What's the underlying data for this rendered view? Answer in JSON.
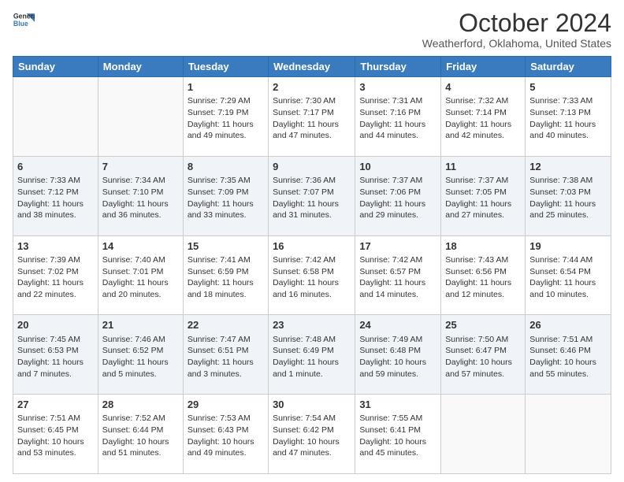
{
  "header": {
    "logo_line1": "General",
    "logo_line2": "Blue",
    "title": "October 2024",
    "subtitle": "Weatherford, Oklahoma, United States"
  },
  "days_of_week": [
    "Sunday",
    "Monday",
    "Tuesday",
    "Wednesday",
    "Thursday",
    "Friday",
    "Saturday"
  ],
  "weeks": [
    [
      {
        "day": "",
        "sunrise": "",
        "sunset": "",
        "daylight": ""
      },
      {
        "day": "",
        "sunrise": "",
        "sunset": "",
        "daylight": ""
      },
      {
        "day": "1",
        "sunrise": "Sunrise: 7:29 AM",
        "sunset": "Sunset: 7:19 PM",
        "daylight": "Daylight: 11 hours and 49 minutes."
      },
      {
        "day": "2",
        "sunrise": "Sunrise: 7:30 AM",
        "sunset": "Sunset: 7:17 PM",
        "daylight": "Daylight: 11 hours and 47 minutes."
      },
      {
        "day": "3",
        "sunrise": "Sunrise: 7:31 AM",
        "sunset": "Sunset: 7:16 PM",
        "daylight": "Daylight: 11 hours and 44 minutes."
      },
      {
        "day": "4",
        "sunrise": "Sunrise: 7:32 AM",
        "sunset": "Sunset: 7:14 PM",
        "daylight": "Daylight: 11 hours and 42 minutes."
      },
      {
        "day": "5",
        "sunrise": "Sunrise: 7:33 AM",
        "sunset": "Sunset: 7:13 PM",
        "daylight": "Daylight: 11 hours and 40 minutes."
      }
    ],
    [
      {
        "day": "6",
        "sunrise": "Sunrise: 7:33 AM",
        "sunset": "Sunset: 7:12 PM",
        "daylight": "Daylight: 11 hours and 38 minutes."
      },
      {
        "day": "7",
        "sunrise": "Sunrise: 7:34 AM",
        "sunset": "Sunset: 7:10 PM",
        "daylight": "Daylight: 11 hours and 36 minutes."
      },
      {
        "day": "8",
        "sunrise": "Sunrise: 7:35 AM",
        "sunset": "Sunset: 7:09 PM",
        "daylight": "Daylight: 11 hours and 33 minutes."
      },
      {
        "day": "9",
        "sunrise": "Sunrise: 7:36 AM",
        "sunset": "Sunset: 7:07 PM",
        "daylight": "Daylight: 11 hours and 31 minutes."
      },
      {
        "day": "10",
        "sunrise": "Sunrise: 7:37 AM",
        "sunset": "Sunset: 7:06 PM",
        "daylight": "Daylight: 11 hours and 29 minutes."
      },
      {
        "day": "11",
        "sunrise": "Sunrise: 7:37 AM",
        "sunset": "Sunset: 7:05 PM",
        "daylight": "Daylight: 11 hours and 27 minutes."
      },
      {
        "day": "12",
        "sunrise": "Sunrise: 7:38 AM",
        "sunset": "Sunset: 7:03 PM",
        "daylight": "Daylight: 11 hours and 25 minutes."
      }
    ],
    [
      {
        "day": "13",
        "sunrise": "Sunrise: 7:39 AM",
        "sunset": "Sunset: 7:02 PM",
        "daylight": "Daylight: 11 hours and 22 minutes."
      },
      {
        "day": "14",
        "sunrise": "Sunrise: 7:40 AM",
        "sunset": "Sunset: 7:01 PM",
        "daylight": "Daylight: 11 hours and 20 minutes."
      },
      {
        "day": "15",
        "sunrise": "Sunrise: 7:41 AM",
        "sunset": "Sunset: 6:59 PM",
        "daylight": "Daylight: 11 hours and 18 minutes."
      },
      {
        "day": "16",
        "sunrise": "Sunrise: 7:42 AM",
        "sunset": "Sunset: 6:58 PM",
        "daylight": "Daylight: 11 hours and 16 minutes."
      },
      {
        "day": "17",
        "sunrise": "Sunrise: 7:42 AM",
        "sunset": "Sunset: 6:57 PM",
        "daylight": "Daylight: 11 hours and 14 minutes."
      },
      {
        "day": "18",
        "sunrise": "Sunrise: 7:43 AM",
        "sunset": "Sunset: 6:56 PM",
        "daylight": "Daylight: 11 hours and 12 minutes."
      },
      {
        "day": "19",
        "sunrise": "Sunrise: 7:44 AM",
        "sunset": "Sunset: 6:54 PM",
        "daylight": "Daylight: 11 hours and 10 minutes."
      }
    ],
    [
      {
        "day": "20",
        "sunrise": "Sunrise: 7:45 AM",
        "sunset": "Sunset: 6:53 PM",
        "daylight": "Daylight: 11 hours and 7 minutes."
      },
      {
        "day": "21",
        "sunrise": "Sunrise: 7:46 AM",
        "sunset": "Sunset: 6:52 PM",
        "daylight": "Daylight: 11 hours and 5 minutes."
      },
      {
        "day": "22",
        "sunrise": "Sunrise: 7:47 AM",
        "sunset": "Sunset: 6:51 PM",
        "daylight": "Daylight: 11 hours and 3 minutes."
      },
      {
        "day": "23",
        "sunrise": "Sunrise: 7:48 AM",
        "sunset": "Sunset: 6:49 PM",
        "daylight": "Daylight: 11 hours and 1 minute."
      },
      {
        "day": "24",
        "sunrise": "Sunrise: 7:49 AM",
        "sunset": "Sunset: 6:48 PM",
        "daylight": "Daylight: 10 hours and 59 minutes."
      },
      {
        "day": "25",
        "sunrise": "Sunrise: 7:50 AM",
        "sunset": "Sunset: 6:47 PM",
        "daylight": "Daylight: 10 hours and 57 minutes."
      },
      {
        "day": "26",
        "sunrise": "Sunrise: 7:51 AM",
        "sunset": "Sunset: 6:46 PM",
        "daylight": "Daylight: 10 hours and 55 minutes."
      }
    ],
    [
      {
        "day": "27",
        "sunrise": "Sunrise: 7:51 AM",
        "sunset": "Sunset: 6:45 PM",
        "daylight": "Daylight: 10 hours and 53 minutes."
      },
      {
        "day": "28",
        "sunrise": "Sunrise: 7:52 AM",
        "sunset": "Sunset: 6:44 PM",
        "daylight": "Daylight: 10 hours and 51 minutes."
      },
      {
        "day": "29",
        "sunrise": "Sunrise: 7:53 AM",
        "sunset": "Sunset: 6:43 PM",
        "daylight": "Daylight: 10 hours and 49 minutes."
      },
      {
        "day": "30",
        "sunrise": "Sunrise: 7:54 AM",
        "sunset": "Sunset: 6:42 PM",
        "daylight": "Daylight: 10 hours and 47 minutes."
      },
      {
        "day": "31",
        "sunrise": "Sunrise: 7:55 AM",
        "sunset": "Sunset: 6:41 PM",
        "daylight": "Daylight: 10 hours and 45 minutes."
      },
      {
        "day": "",
        "sunrise": "",
        "sunset": "",
        "daylight": ""
      },
      {
        "day": "",
        "sunrise": "",
        "sunset": "",
        "daylight": ""
      }
    ]
  ]
}
